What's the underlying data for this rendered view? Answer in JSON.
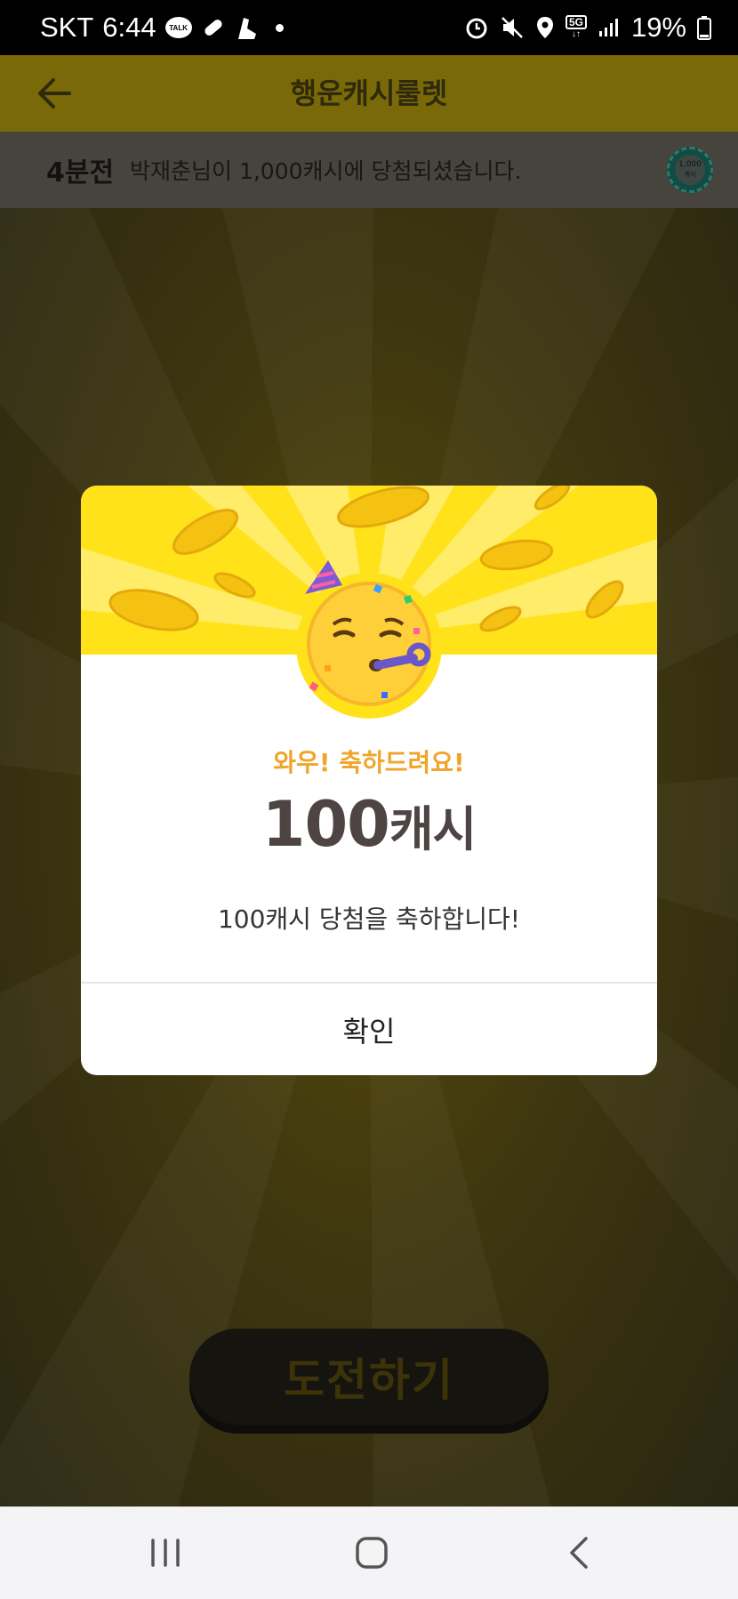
{
  "status_bar": {
    "carrier": "SKT",
    "time": "6:44",
    "talk_badge": "TALK",
    "network": "5G",
    "battery": "19%"
  },
  "header": {
    "title": "행운캐시룰렛"
  },
  "ticker": {
    "time_ago": "4분전",
    "message": "박재춘님이 1,000캐시에 당첨되셨습니다.",
    "chip_value": "1,000",
    "chip_unit": "캐시"
  },
  "challenge_button": {
    "label": "도전하기"
  },
  "modal": {
    "subtitle": "와우! 축하드려요!",
    "amount_number": "100",
    "amount_unit": "캐시",
    "message": "100캐시 당첨을 축하합니다!",
    "confirm_label": "확인"
  },
  "colors": {
    "accent_yellow": "#ffe21a",
    "subtitle_orange": "#f0a52a",
    "amount_text": "#4e4444"
  },
  "icons": {
    "back": "arrow-left-icon",
    "emoji": "partying-face-icon",
    "nav_recent": "recent-apps-icon",
    "nav_home": "home-icon",
    "nav_back": "back-icon"
  }
}
